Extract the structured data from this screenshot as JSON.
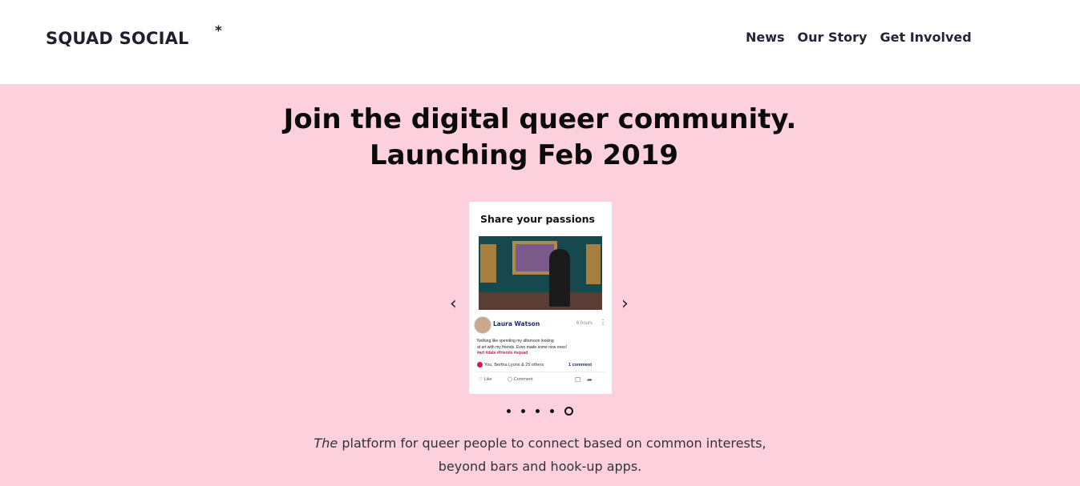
{
  "header": {
    "logo_text": "SQUAD SOCIAL",
    "logo_mark": "*",
    "nav": [
      {
        "label": "News"
      },
      {
        "label": "Our Story"
      },
      {
        "label": "Get Involved"
      }
    ]
  },
  "hero": {
    "headline_line1": "Join the digital queer community.",
    "headline_line2": "Launching Feb 2019",
    "background_color": "#fdd0de",
    "carousel": {
      "prev_icon": "chevron-left-icon",
      "next_icon": "chevron-right-icon",
      "slide_count": 5,
      "active_index": 4,
      "card": {
        "title": "Share your passions",
        "user_name": "Laura Watson",
        "time": "6 hours",
        "post_text_line1": "Nothing like spending my afternoon looking",
        "post_text_line2": "at art with my friends. Even made some new ones!",
        "tags": "#art  #date  #friends  #squad",
        "likes": "You, Bertha Lyons & 25 others",
        "comment_count": "1 comment",
        "like_label": "Like",
        "comment_label": "Comment"
      }
    },
    "tagline_em": "The",
    "tagline_rest": " platform for queer people to connect based on common interests,",
    "tagline_line2": "beyond bars and hook-up apps."
  }
}
